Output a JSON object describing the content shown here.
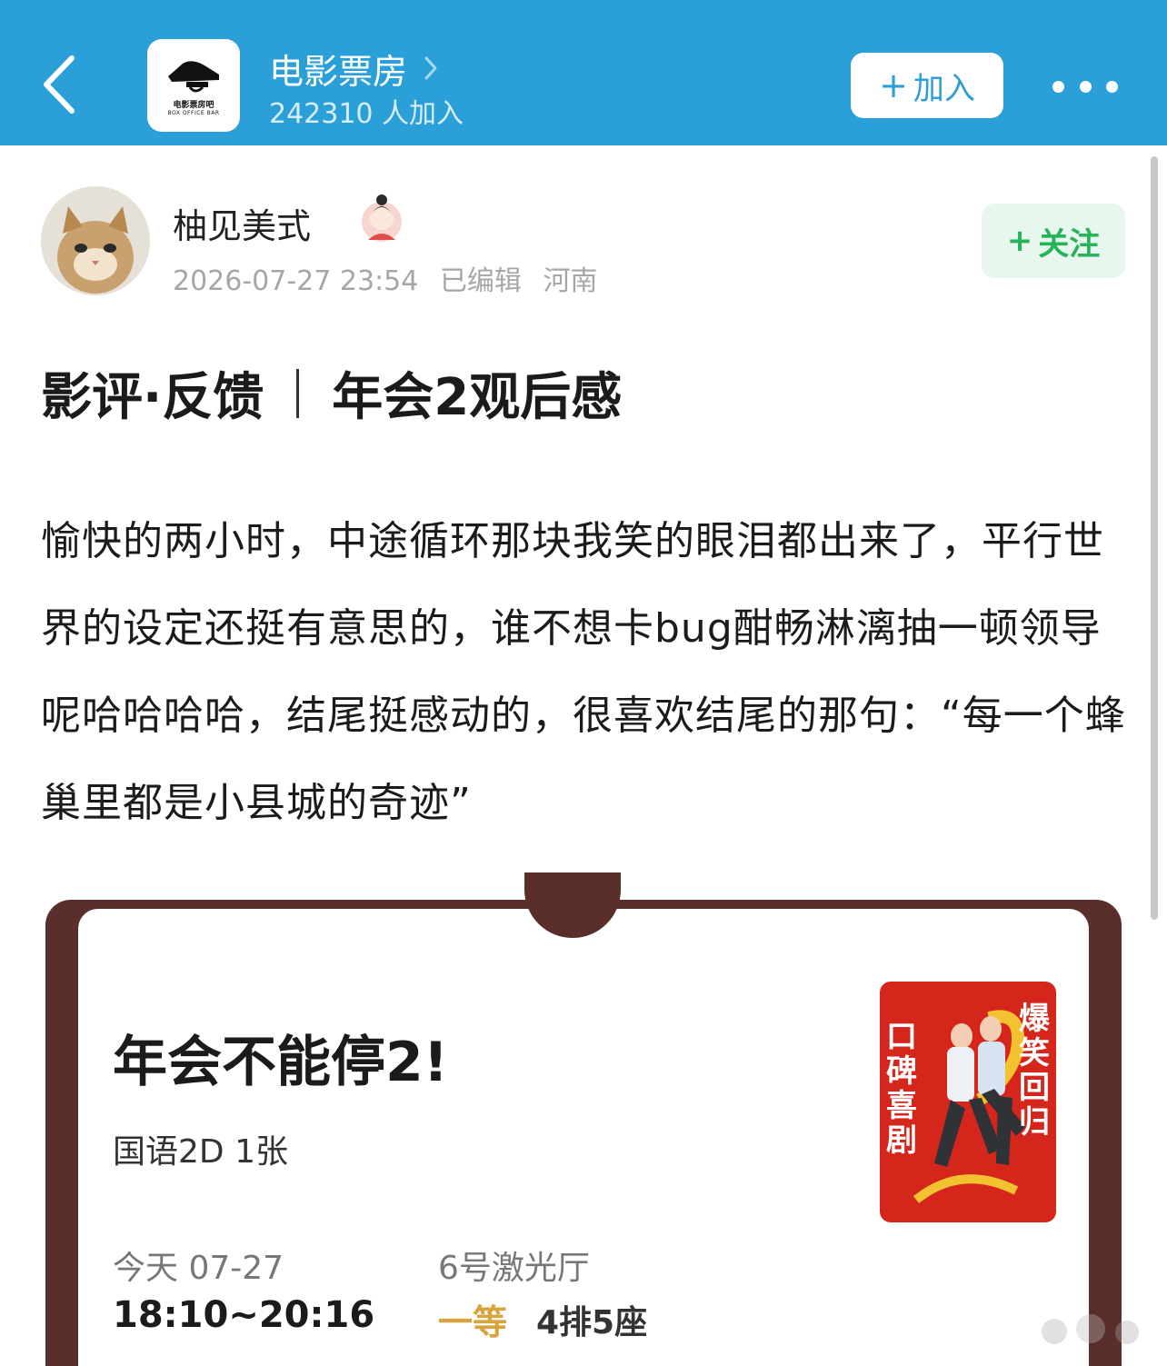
{
  "header": {
    "forum_name": "电影票房",
    "members": "242310 人加入",
    "join_label": "加入",
    "logo_text_cn": "电影票房吧",
    "logo_text_en": "BOX OFFICE BAR",
    "accent_color": "#2a9fd8"
  },
  "author": {
    "name": "柚见美式",
    "date": "2026-07-27 23:54",
    "edited": "已编辑",
    "location": "河南",
    "follow_label": "关注",
    "follow_color": "#27b35a"
  },
  "post": {
    "title_tag": "影评·反馈",
    "title_main": "年会2观后感",
    "body": "愉快的两小时，中途循环那块我笑的眼泪都出来了，平行世界的设定还挺有意思的，谁不想卡bug酣畅淋漓抽一顿领导呢哈哈哈哈，结尾挺感动的，很喜欢结尾的那句：“每一个蜂巢里都是小县城的奇迹”"
  },
  "ticket": {
    "movie_title": "年会不能停2!",
    "language": "国语2D 1张",
    "date_label": "今天 07-27",
    "time_range": "18:10~20:16",
    "hall": "6号激光厅",
    "seat_class": "一等",
    "seat": "4排5座",
    "poster_left": "口碑喜剧",
    "poster_right": "爆笑回归",
    "poster_color": "#d5261c",
    "frame_color": "#5a2f2b"
  },
  "icons": [
    "back-arrow-icon",
    "chevron-right-icon",
    "more-dots-icon",
    "plus-icon",
    "cat-avatar-icon",
    "badge-icon"
  ]
}
